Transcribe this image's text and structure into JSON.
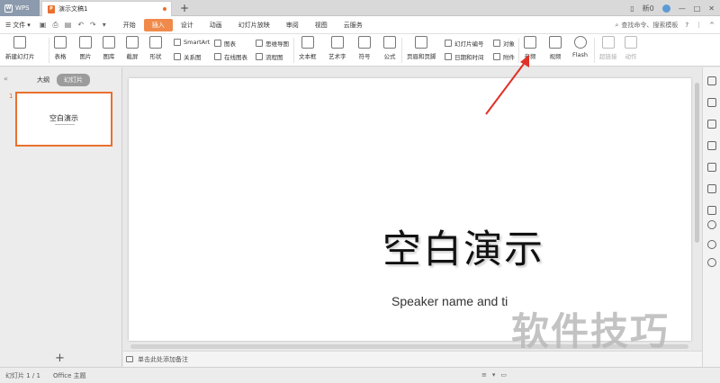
{
  "app": {
    "name": "WPS",
    "doc_tab": "演示文稿1",
    "doc_icon_letter": "P",
    "new_tab": "+"
  },
  "window": {
    "user_label": "新0"
  },
  "menubar": {
    "file": "文件",
    "items": [
      "开始",
      "插入",
      "设计",
      "动画",
      "幻灯片放映",
      "审阅",
      "视图",
      "云服务"
    ],
    "active": "插入",
    "search_placeholder": "查找命令、搜索模板",
    "help": "?"
  },
  "ribbon": {
    "new_slide": "新建幻灯片",
    "table": "表格",
    "picture": "图片",
    "gallery": "图库",
    "screenshot": "截屏",
    "shape": "形状",
    "smartart": "SmartArt",
    "chart": "图表",
    "mindmap": "思维导图",
    "relation": "关系图",
    "online_chart": "在线图表",
    "flowchart": "流程图",
    "textbox": "文本框",
    "wordart": "艺术字",
    "symbol": "符号",
    "formula": "公式",
    "header_footer": "页眉和页脚",
    "slide_number": "幻灯片编号",
    "object": "对象",
    "datetime": "日期和时间",
    "attachment": "附件",
    "audio": "音频",
    "video": "视频",
    "flash": "Flash",
    "hyperlink": "超链接",
    "action": "动作"
  },
  "leftpanel": {
    "outline_tab": "大纲",
    "slides_tab": "幻灯片",
    "slide_number": "1",
    "thumb_title": "空白演示",
    "add": "+"
  },
  "slide": {
    "title": "空白演示",
    "speaker": "Speaker name and ti"
  },
  "notes": {
    "placeholder": "单击此处添加备注"
  },
  "statusbar": {
    "slide_info": "幻灯片 1 / 1",
    "theme": "Office 主题"
  },
  "watermark": "软件技巧",
  "colors": {
    "accent": "#e9702d",
    "active_menu": "#f08a4b",
    "arrow": "#e0322a"
  }
}
